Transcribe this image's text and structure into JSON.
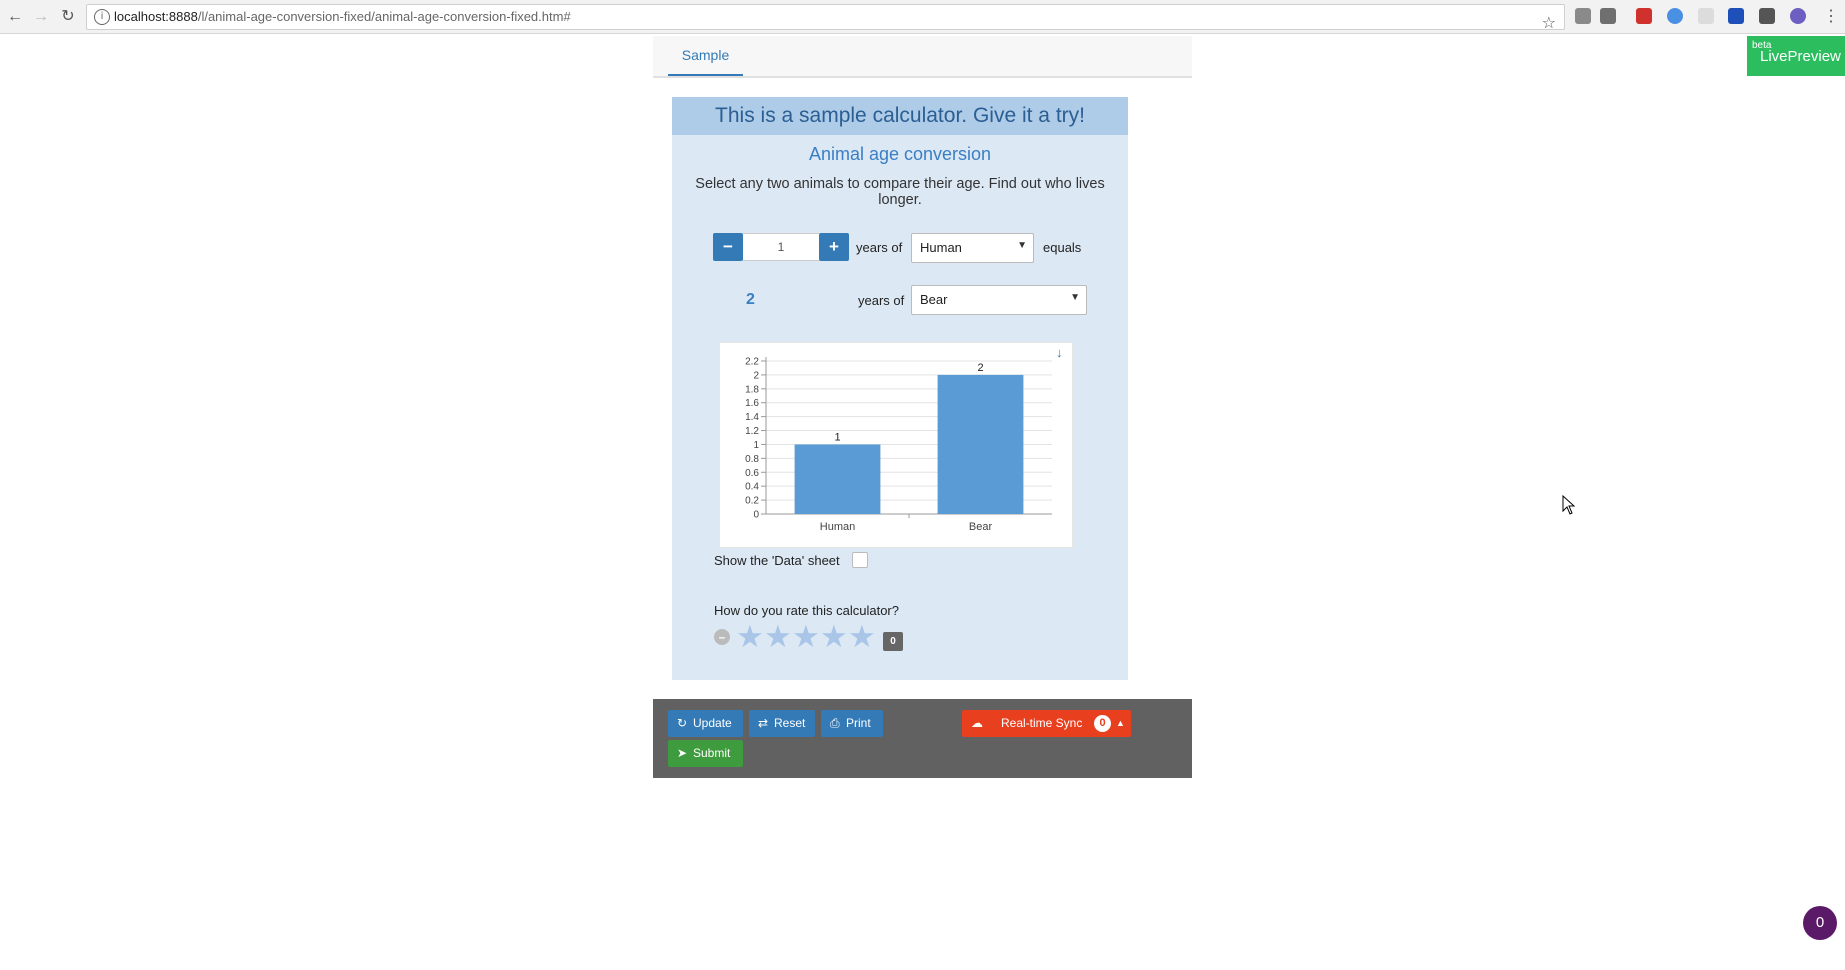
{
  "browser": {
    "url_host": "localhost:8888",
    "url_path": "/l/animal-age-conversion-fixed/animal-age-conversion-fixed.htm#"
  },
  "livepreview": {
    "beta": "beta",
    "label": "LivePreview"
  },
  "tabs": [
    {
      "label": "Sample",
      "active": true
    }
  ],
  "calculator": {
    "header": "This is a sample calculator. Give it a try!",
    "title": "Animal age conversion",
    "description": "Select any two animals to compare their age. Find out who lives longer.",
    "input_value": "1",
    "minus_label": "−",
    "plus_label": "+",
    "years_of_label": "years of",
    "equals_label": "equals",
    "animal_from": "Human",
    "result_value": "2",
    "animal_to": "Bear",
    "show_data_sheet_label": "Show the 'Data' sheet",
    "rating_question": "How do you rate this calculator?",
    "rating_count": "0",
    "rating_value": 0,
    "rating_max": 5
  },
  "chart_data": {
    "type": "bar",
    "categories": [
      "Human",
      "Bear"
    ],
    "values": [
      1,
      2
    ],
    "data_labels": [
      "1",
      "2"
    ],
    "ylim": [
      0,
      2.2
    ],
    "y_ticks": [
      "0",
      "0.2",
      "0.4",
      "0.6",
      "0.8",
      "1",
      "1.2",
      "1.4",
      "1.6",
      "1.8",
      "2",
      "2.2"
    ],
    "bar_color": "#5b9bd5",
    "grid": true
  },
  "toolbar": {
    "update_label": "Update",
    "reset_label": "Reset",
    "print_label": "Print",
    "sync_label": "Real-time Sync",
    "sync_count": "0",
    "submit_label": "Submit"
  },
  "chat_bubble_count": "0",
  "colors": {
    "primary": "#337ab7",
    "success": "#3e9c3e",
    "danger": "#e8401f",
    "livepreview": "#2bbd5e",
    "panel_bg": "#dce8f4"
  }
}
